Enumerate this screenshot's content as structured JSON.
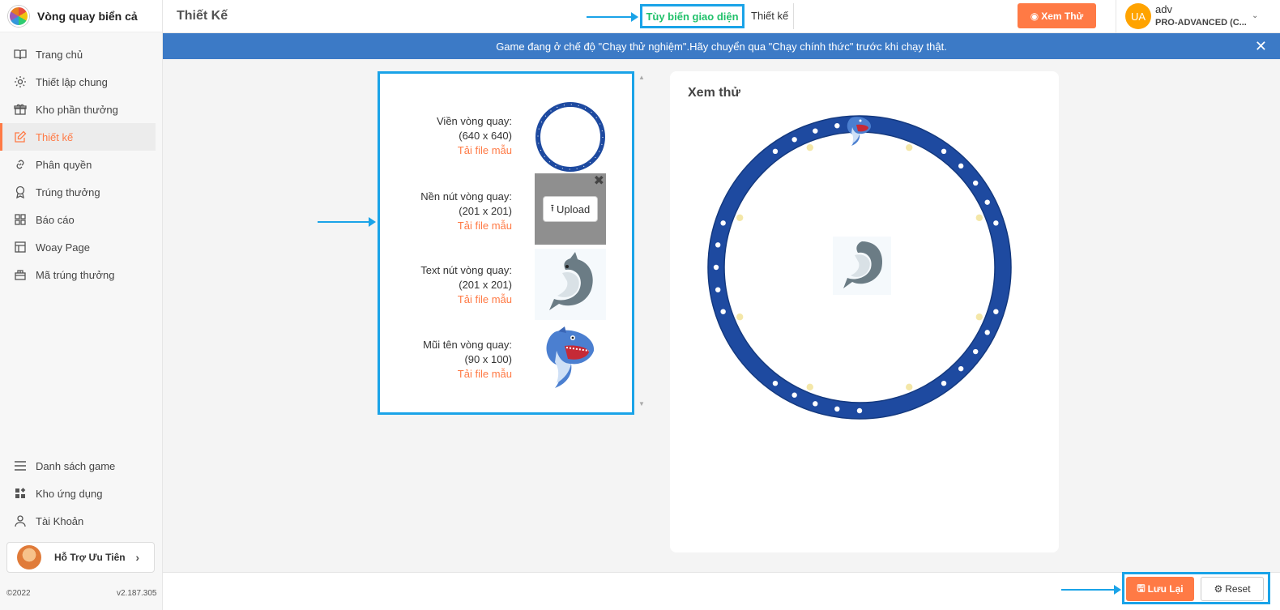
{
  "app": {
    "name": "Vòng quay biển cả"
  },
  "sidebar": {
    "items": [
      {
        "label": "Trang chủ",
        "icon": "book-icon"
      },
      {
        "label": "Thiết lập chung",
        "icon": "gear-icon"
      },
      {
        "label": "Kho phần thưởng",
        "icon": "gift-icon"
      },
      {
        "label": "Thiết kế",
        "icon": "edit-icon",
        "active": true
      },
      {
        "label": "Phân quyền",
        "icon": "link-icon"
      },
      {
        "label": "Trúng thưởng",
        "icon": "award-icon"
      },
      {
        "label": "Báo cáo",
        "icon": "grid-icon"
      },
      {
        "label": "Woay Page",
        "icon": "layout-icon"
      },
      {
        "label": "Mã trúng thưởng",
        "icon": "ticket-icon"
      }
    ],
    "bottom_items": [
      {
        "label": "Danh sách game",
        "icon": "menu-icon"
      },
      {
        "label": "Kho ứng dụng",
        "icon": "apps-icon"
      },
      {
        "label": "Tài Khoản",
        "icon": "user-icon"
      }
    ],
    "support_label": "Hỗ Trợ Ưu Tiên",
    "copyright": "©2022",
    "version": "v2.187.305"
  },
  "header": {
    "page_title": "Thiết Kế",
    "tab_custom": "Tùy biến giao diện",
    "tab_design": "Thiết kế",
    "preview_button": "Xem Thử",
    "user": {
      "initials": "UA",
      "name": "adv",
      "plan": "PRO-ADVANCED (C..."
    }
  },
  "banner": {
    "text": "Game đang ở chế độ \"Chạy thử nghiệm\".Hãy chuyển qua \"Chạy chính thức\" trước khi chạy thật."
  },
  "upload": {
    "download_label": "Tải file mẫu",
    "upload_button": "Upload",
    "rows": [
      {
        "label": "Viền vòng quay:",
        "size": "(640 x 640)"
      },
      {
        "label": "Nền nút vòng quay:",
        "size": "(201 x 201)"
      },
      {
        "label": "Text nút vòng quay:",
        "size": "(201 x 201)"
      },
      {
        "label": "Mũi tên vòng quay:",
        "size": "(90 x 100)"
      }
    ]
  },
  "preview": {
    "title": "Xem thử"
  },
  "actions": {
    "save": "Lưu Lại",
    "reset": "Reset"
  },
  "colors": {
    "accent": "#ff7a45",
    "banner": "#3c7ac6",
    "highlight": "#1aa3e8",
    "active_tab": "#21c16b",
    "wheel": "#1e4aa0"
  }
}
